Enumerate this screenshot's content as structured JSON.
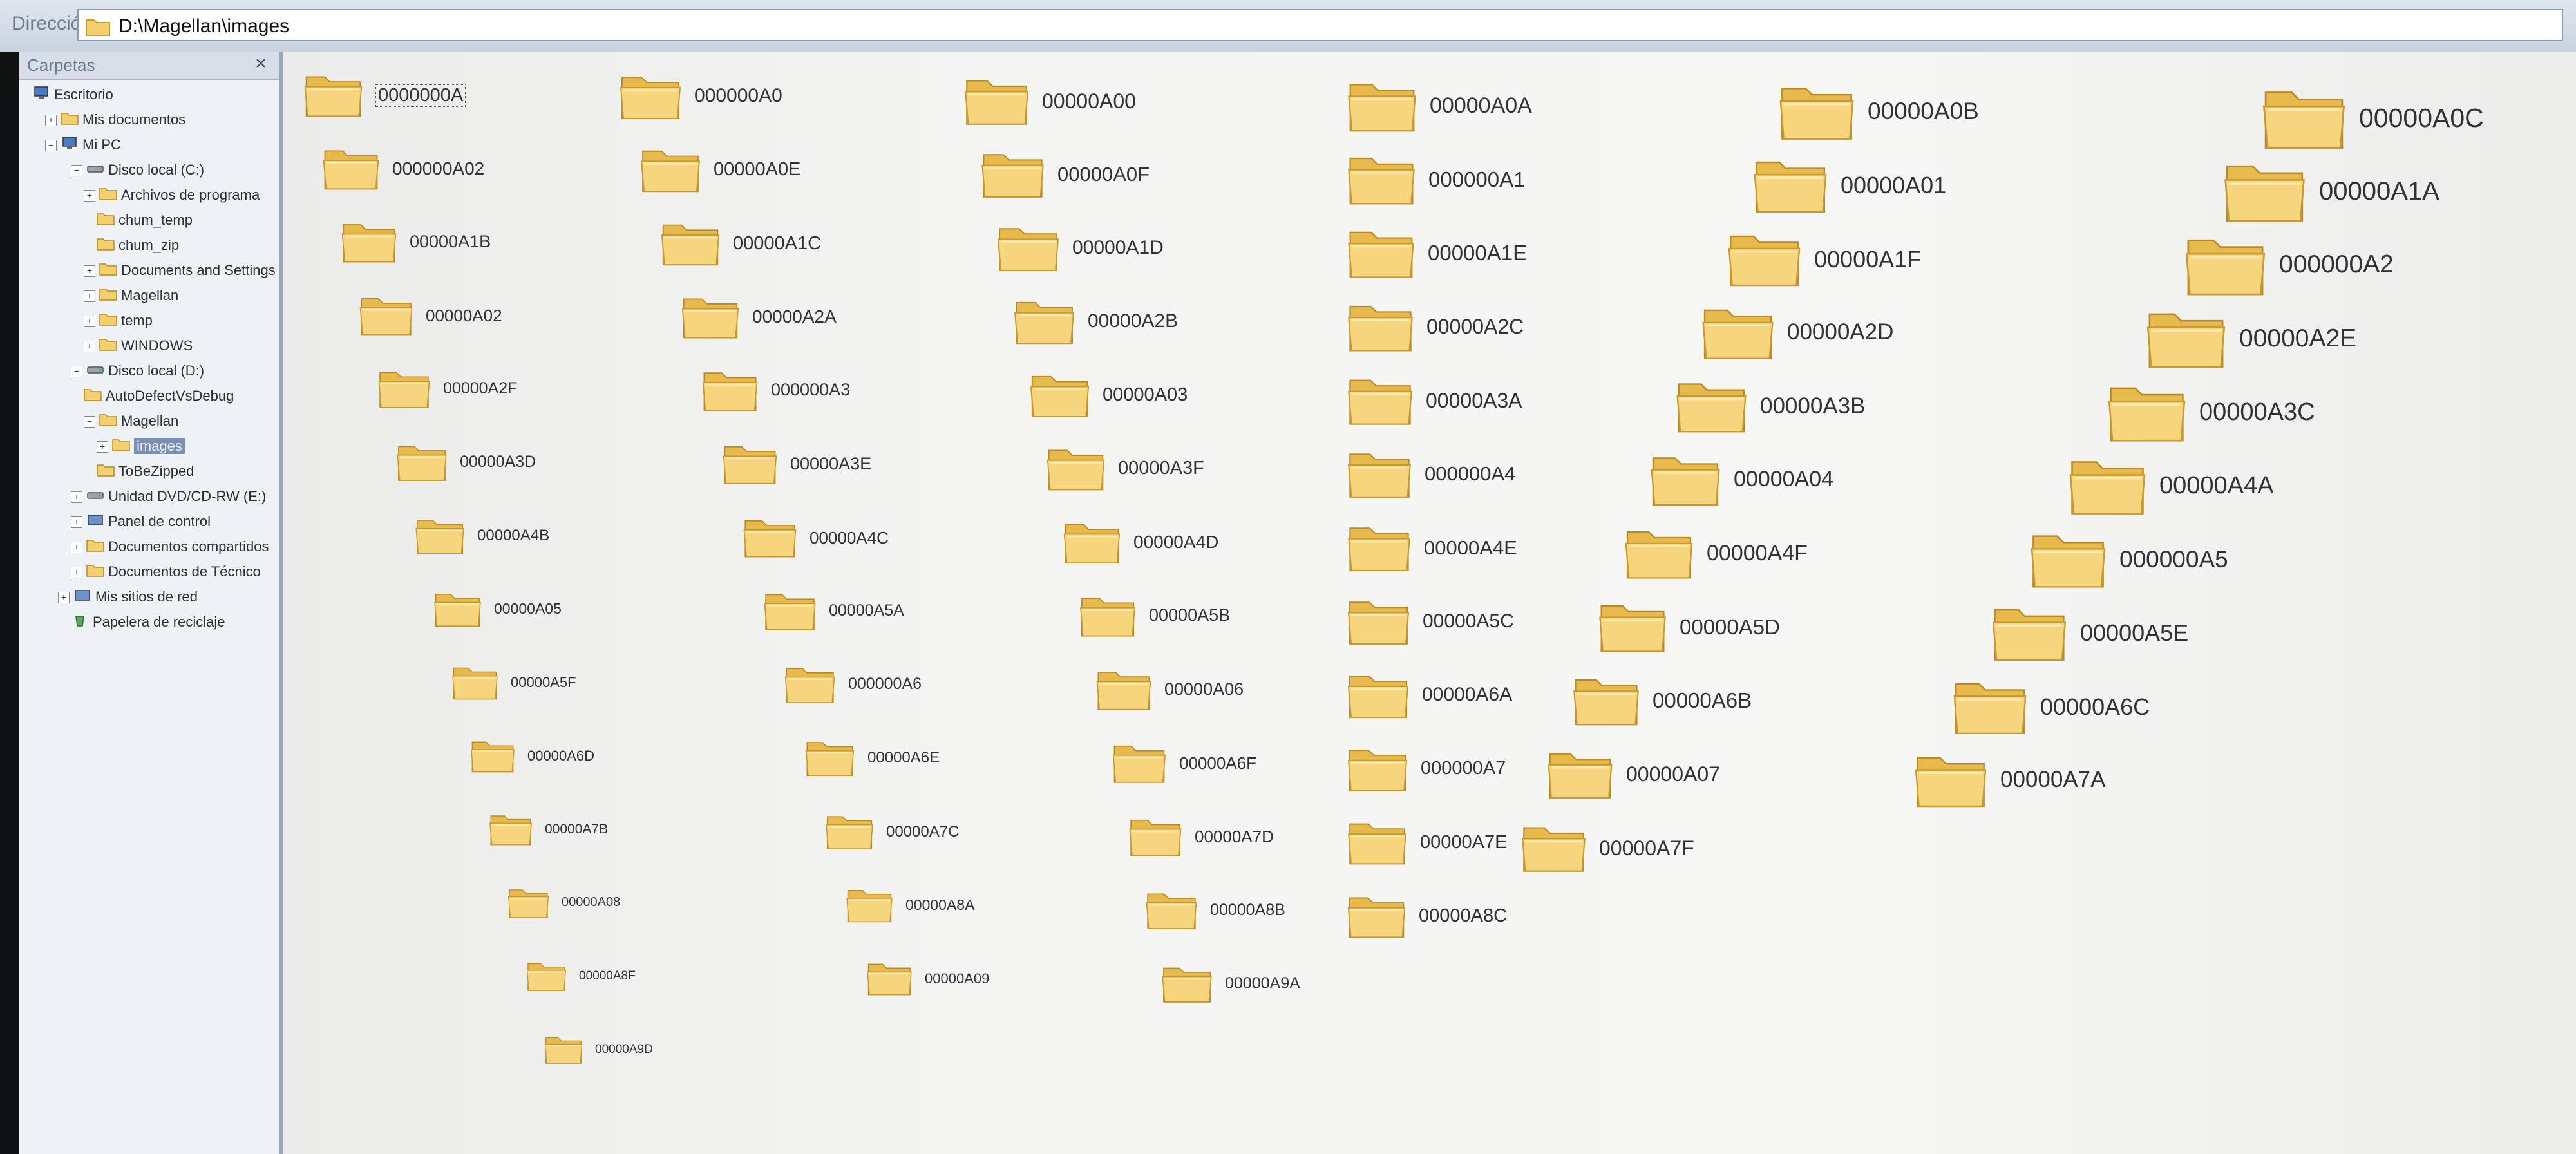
{
  "address": {
    "label": "Dirección",
    "path": "D:\\Magellan\\images"
  },
  "tree": {
    "title": "Carpetas",
    "close": "×",
    "items": [
      {
        "label": "Escritorio",
        "icon": "desktop-icon",
        "exp": ""
      },
      {
        "label": "Mis documentos",
        "icon": "folder-icon",
        "exp": "+"
      },
      {
        "label": "Mi PC",
        "icon": "computer-icon",
        "exp": "−"
      },
      {
        "label": "Disco local (C:)",
        "icon": "drive-icon",
        "exp": "−"
      },
      {
        "label": "Archivos de programa",
        "icon": "folder-icon",
        "exp": "+"
      },
      {
        "label": "chum_temp",
        "icon": "folder-icon",
        "exp": ""
      },
      {
        "label": "chum_zip",
        "icon": "folder-icon",
        "exp": ""
      },
      {
        "label": "Documents and Settings",
        "icon": "folder-icon",
        "exp": "+"
      },
      {
        "label": "Magellan",
        "icon": "folder-icon",
        "exp": "+"
      },
      {
        "label": "temp",
        "icon": "folder-icon",
        "exp": "+"
      },
      {
        "label": "WINDOWS",
        "icon": "folder-icon",
        "exp": "+"
      },
      {
        "label": "Disco local (D:)",
        "icon": "drive-icon",
        "exp": "−"
      },
      {
        "label": "AutoDefectVsDebug",
        "icon": "folder-icon",
        "exp": ""
      },
      {
        "label": "Magellan",
        "icon": "folder-icon",
        "exp": "−"
      },
      {
        "label": "images",
        "icon": "folder-icon",
        "exp": "+"
      },
      {
        "label": "ToBeZipped",
        "icon": "folder-icon",
        "exp": ""
      },
      {
        "label": "Unidad DVD/CD-RW (E:)",
        "icon": "cd-drive-icon",
        "exp": "+"
      },
      {
        "label": "Panel de control",
        "icon": "control-panel-icon",
        "exp": "+"
      },
      {
        "label": "Documentos compartidos",
        "icon": "folder-icon",
        "exp": "+"
      },
      {
        "label": "Documentos de Técnico",
        "icon": "folder-icon",
        "exp": "+"
      },
      {
        "label": "Mis sitios de red",
        "icon": "network-icon",
        "exp": "+"
      },
      {
        "label": "Papelera de reciclaje",
        "icon": "recycle-bin-icon",
        "exp": ""
      }
    ]
  },
  "folders": {
    "columns": [
      [
        "0000000A",
        "000000A02",
        "00000A1B",
        "00000A02",
        "00000A2F",
        "00000A3D",
        "00000A4B",
        "00000A05",
        "00000A5F",
        "00000A6D",
        "00000A7B",
        "00000A08",
        "00000A8F",
        "00000A9D"
      ],
      [
        "000000A0",
        "00000A0E",
        "00000A1C",
        "00000A2A",
        "000000A3",
        "00000A3E",
        "00000A4C",
        "00000A5A",
        "000000A6",
        "00000A6E",
        "00000A7C",
        "00000A8A",
        "00000A09"
      ],
      [
        "00000A00",
        "00000A0F",
        "00000A1D",
        "00000A2B",
        "00000A03",
        "00000A3F",
        "00000A4D",
        "00000A5B",
        "00000A06",
        "00000A6F",
        "00000A7D",
        "00000A8B",
        "00000A9A"
      ],
      [
        "00000A0A",
        "000000A1",
        "00000A1E",
        "00000A2C",
        "00000A3A",
        "000000A4",
        "00000A4E",
        "00000A5C",
        "00000A6A",
        "000000A7",
        "00000A7E",
        "00000A8C"
      ],
      [
        "00000A0B",
        "00000A01",
        "00000A1F",
        "00000A2D",
        "00000A3B",
        "00000A04",
        "00000A4F",
        "00000A5D",
        "00000A6B",
        "00000A07",
        "00000A7F"
      ],
      [
        "00000A0C",
        "00000A1A",
        "000000A2",
        "00000A2E",
        "00000A3C",
        "00000A4A",
        "000000A5",
        "00000A5E",
        "00000A6C",
        "00000A7A"
      ]
    ]
  },
  "colors": {
    "folder_fill": "#f3cf6e",
    "folder_dark": "#c79a2f",
    "folder_light": "#fbe6a3",
    "selection": "#7b8fb0"
  }
}
